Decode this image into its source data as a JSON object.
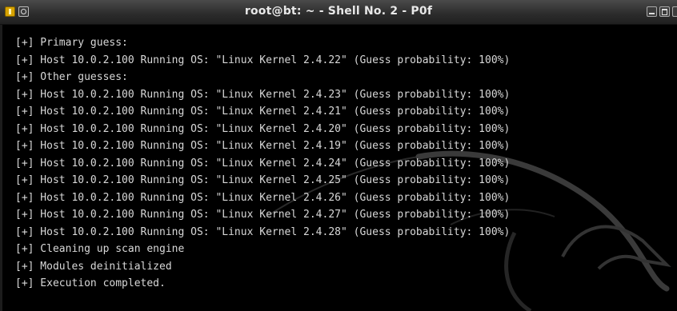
{
  "window": {
    "title": "root@bt: ~ - Shell No. 2 - P0f"
  },
  "titlebar": {
    "left_icons": [
      "app-icon",
      "pin-icon"
    ],
    "right_icons": [
      "minimize-icon",
      "maximize-icon",
      "close-icon"
    ]
  },
  "terminal": {
    "lines": [
      "[+] Primary guess:",
      "[+] Host 10.0.2.100 Running OS: \"Linux Kernel 2.4.22\" (Guess probability: 100%)",
      "[+] Other guesses:",
      "[+] Host 10.0.2.100 Running OS: \"Linux Kernel 2.4.23\" (Guess probability: 100%)",
      "[+] Host 10.0.2.100 Running OS: \"Linux Kernel 2.4.21\" (Guess probability: 100%)",
      "[+] Host 10.0.2.100 Running OS: \"Linux Kernel 2.4.20\" (Guess probability: 100%)",
      "[+] Host 10.0.2.100 Running OS: \"Linux Kernel 2.4.19\" (Guess probability: 100%)",
      "[+] Host 10.0.2.100 Running OS: \"Linux Kernel 2.4.24\" (Guess probability: 100%)",
      "[+] Host 10.0.2.100 Running OS: \"Linux Kernel 2.4.25\" (Guess probability: 100%)",
      "[+] Host 10.0.2.100 Running OS: \"Linux Kernel 2.4.26\" (Guess probability: 100%)",
      "[+] Host 10.0.2.100 Running OS: \"Linux Kernel 2.4.27\" (Guess probability: 100%)",
      "[+] Host 10.0.2.100 Running OS: \"Linux Kernel 2.4.28\" (Guess probability: 100%)",
      "[+] Cleaning up scan engine",
      "[+] Modules deinitialized",
      "[+] Execution completed."
    ]
  },
  "colors": {
    "background": "#000000",
    "text": "#d8d8d8",
    "titlebar": "#2b2b2b",
    "title_text": "#e8e8e8"
  }
}
